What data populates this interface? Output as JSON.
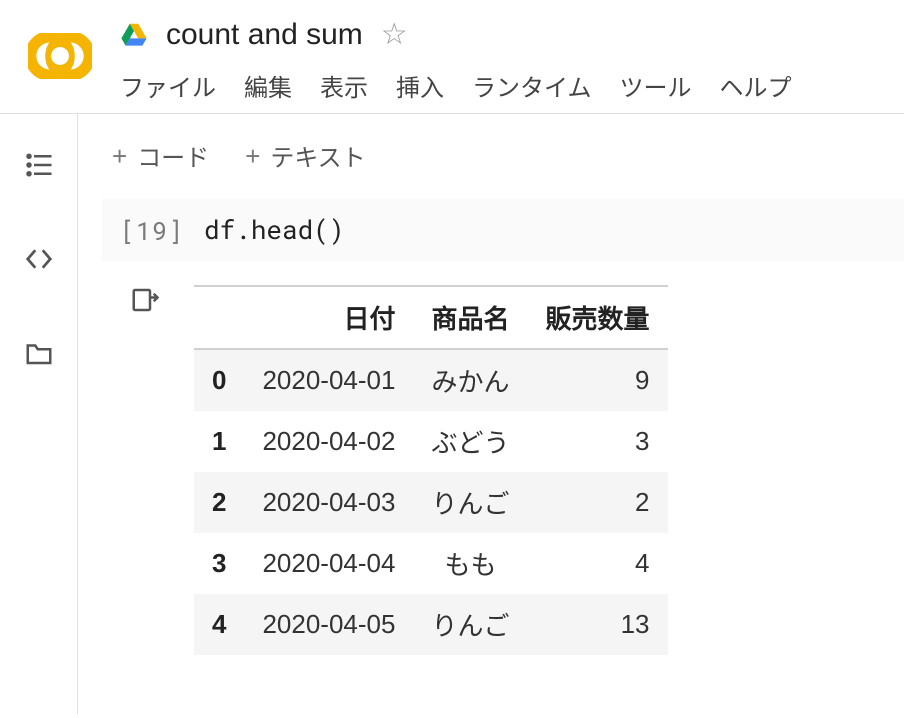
{
  "header": {
    "doc_title": "count and sum",
    "star_glyph": "☆"
  },
  "menu": {
    "items": [
      "ファイル",
      "編集",
      "表示",
      "挿入",
      "ランタイム",
      "ツール",
      "ヘルプ"
    ]
  },
  "toolbar": {
    "code_label": "コード",
    "text_label": "テキスト"
  },
  "cell": {
    "exec_number": "[19]",
    "code": "df.head()"
  },
  "output": {
    "columns": [
      "日付",
      "商品名",
      "販売数量"
    ],
    "rows": [
      {
        "index": "0",
        "date": "2020-04-01",
        "name": "みかん",
        "qty": 9
      },
      {
        "index": "1",
        "date": "2020-04-02",
        "name": "ぶどう",
        "qty": 3
      },
      {
        "index": "2",
        "date": "2020-04-03",
        "name": "りんご",
        "qty": 2
      },
      {
        "index": "3",
        "date": "2020-04-04",
        "name": "もも",
        "qty": 4
      },
      {
        "index": "4",
        "date": "2020-04-05",
        "name": "りんご",
        "qty": 13
      }
    ]
  }
}
